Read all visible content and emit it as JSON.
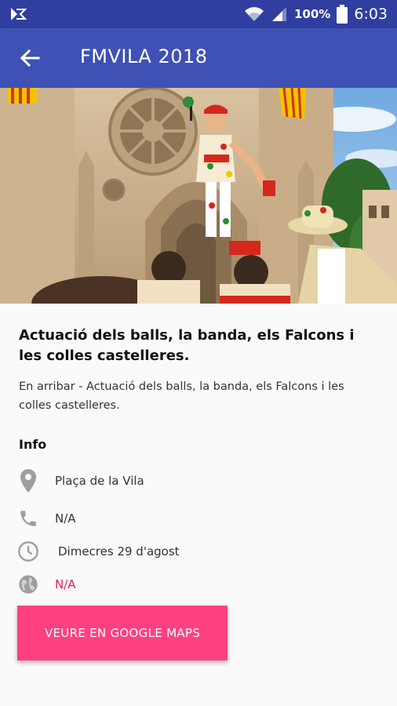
{
  "status_bar": {
    "battery_pct": "100%",
    "time": "6:03",
    "icons": [
      "app-notification-icon",
      "wifi-icon",
      "signal-icon",
      "battery-icon"
    ]
  },
  "app_bar": {
    "title": "FMVILA 2018",
    "back_icon": "arrow-back-icon"
  },
  "hero_image": {
    "subject": "castellers-cathedral-photo"
  },
  "event": {
    "title": "Actuació dels balls, la banda, els Falcons i les colles castelleres.",
    "description": "En arribar - Actuació dels balls, la banda, els Falcons i les colles castelleres."
  },
  "info": {
    "label": "Info",
    "location": "Plaça de la Vila",
    "phone": "N/A",
    "date": "Dimecres 29 d'agost",
    "web": "N/A"
  },
  "actions": {
    "maps_button": "VEURE EN GOOGLE MAPS"
  },
  "colors": {
    "status_bar": "#303f9f",
    "app_bar": "#3f51b5",
    "accent": "#ff4081",
    "link": "#e91e63",
    "icon_gray": "#9e9e9e"
  }
}
